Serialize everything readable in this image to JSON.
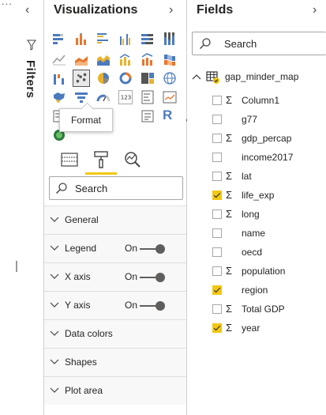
{
  "filters": {
    "label": "Filters",
    "dots": "...",
    "collapse_glyph": "‹"
  },
  "visualizations": {
    "title": "Visualizations",
    "expand_glyph": "›",
    "tooltip": "Format",
    "search_placeholder": "Search",
    "sections": [
      {
        "name": "General",
        "has_toggle": false
      },
      {
        "name": "Legend",
        "has_toggle": true,
        "toggle_label": "On"
      },
      {
        "name": "X axis",
        "has_toggle": true,
        "toggle_label": "On"
      },
      {
        "name": "Y axis",
        "has_toggle": true,
        "toggle_label": "On"
      },
      {
        "name": "Data colors",
        "has_toggle": false
      },
      {
        "name": "Shapes",
        "has_toggle": false
      },
      {
        "name": "Plot area",
        "has_toggle": false
      }
    ],
    "tabs": [
      {
        "name": "fields-tab",
        "icon": "fields-well-icon",
        "active": false
      },
      {
        "name": "format-tab",
        "icon": "paint-roller-icon",
        "active": true
      },
      {
        "name": "analytics-tab",
        "icon": "analytics-magnifier-icon",
        "active": false
      }
    ],
    "accent_color": "#f2c811",
    "r_visual_label": "R"
  },
  "fields": {
    "title": "Fields",
    "expand_glyph": "›",
    "search_placeholder": "Search",
    "table_name": "gap_minder_map",
    "items": [
      {
        "name": "Column1",
        "checked": false,
        "sigma": true
      },
      {
        "name": "g77",
        "checked": false,
        "sigma": false
      },
      {
        "name": "gdp_percap",
        "checked": false,
        "sigma": true
      },
      {
        "name": "income2017",
        "checked": false,
        "sigma": false
      },
      {
        "name": "lat",
        "checked": false,
        "sigma": true
      },
      {
        "name": "life_exp",
        "checked": true,
        "sigma": true
      },
      {
        "name": "long",
        "checked": false,
        "sigma": true
      },
      {
        "name": "name",
        "checked": false,
        "sigma": false
      },
      {
        "name": "oecd",
        "checked": false,
        "sigma": false
      },
      {
        "name": "population",
        "checked": false,
        "sigma": true
      },
      {
        "name": "region",
        "checked": true,
        "sigma": false
      },
      {
        "name": "Total GDP",
        "checked": false,
        "sigma": true
      },
      {
        "name": "year",
        "checked": true,
        "sigma": true
      }
    ],
    "sigma_glyph": "Σ"
  }
}
